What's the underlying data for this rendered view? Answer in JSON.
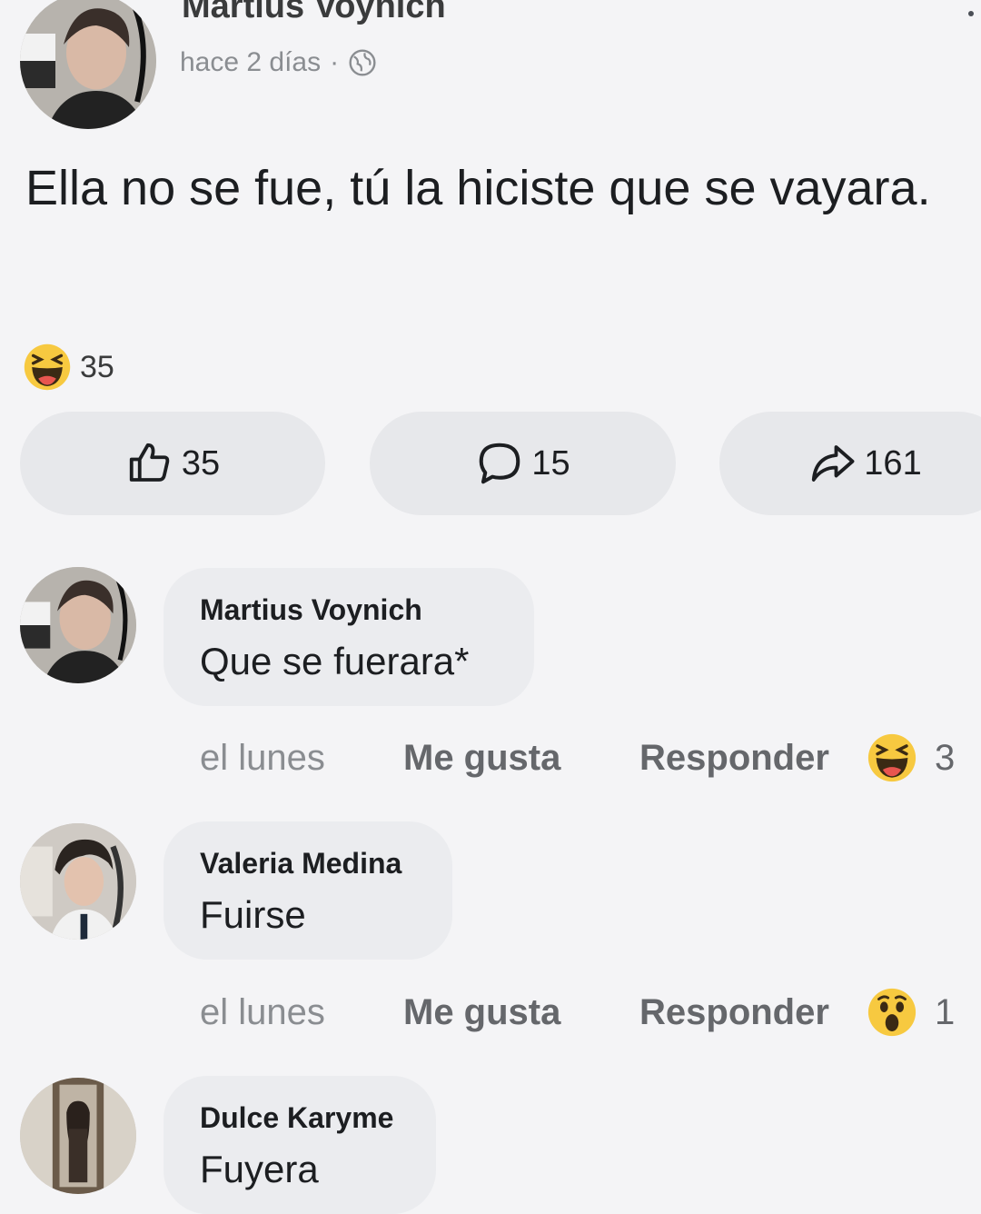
{
  "post": {
    "author": "Martius Voynich",
    "time": "hace 2 días",
    "separator": "·",
    "privacy_icon": "globe-icon",
    "body": "Ella no se fue, tú la hiciste que se vayara.",
    "reaction_icon": "haha-emoji-icon",
    "reaction_count": "35"
  },
  "actions": {
    "like_count": "35",
    "comment_count": "15",
    "share_count": "161"
  },
  "comments": [
    {
      "author": "Martius Voynich",
      "text": "Que se fuerara*",
      "time": "el lunes",
      "like_label": "Me gusta",
      "reply_label": "Responder",
      "reaction_icon": "haha-emoji-icon",
      "reaction_count": "3"
    },
    {
      "author": "Valeria Medina",
      "text": "Fuirse",
      "time": "el lunes",
      "like_label": "Me gusta",
      "reply_label": "Responder",
      "reaction_icon": "wow-emoji-icon",
      "reaction_count": "1"
    },
    {
      "author": "Dulce Karyme",
      "text": "Fuyera"
    }
  ],
  "colors": {
    "background": "#f4f4f6",
    "pill": "#e7e8eb",
    "bubble": "#ebecef",
    "secondary_text": "#65676b",
    "emoji_yellow": "#f7c940"
  }
}
